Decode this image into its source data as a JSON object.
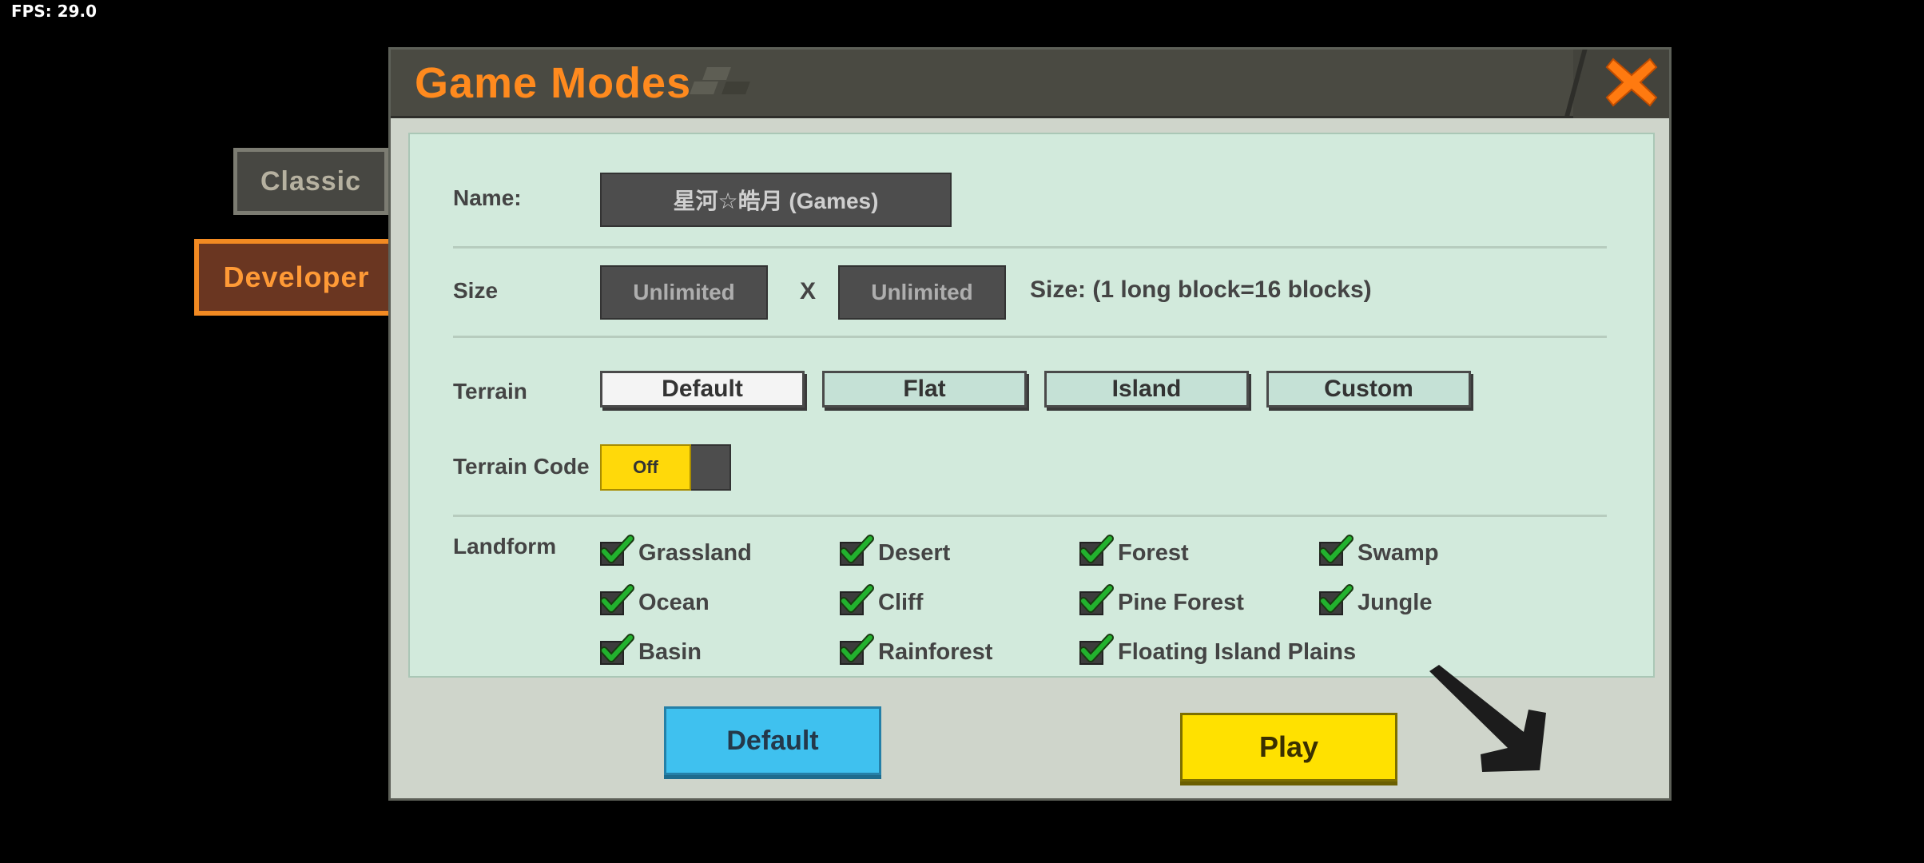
{
  "fps": "FPS: 29.0",
  "tabs": {
    "classic": "Classic",
    "developer": "Developer"
  },
  "dialog": {
    "title": "Game Modes",
    "name_label": "Name:",
    "name_value": "星河☆皓月 (Games)",
    "size_label": "Size",
    "size_width": "Unlimited",
    "size_x": "X",
    "size_height": "Unlimited",
    "size_note": "Size: (1 long block=16 blocks)",
    "terrain_label": "Terrain",
    "terrain_options": [
      "Default",
      "Flat",
      "Island",
      "Custom"
    ],
    "terrain_selected": "Default",
    "terrain_code_label": "Terrain Code",
    "terrain_code_toggle": "Off",
    "landform_label": "Landform",
    "landforms": [
      "Grassland",
      "Desert",
      "Forest",
      "Swamp",
      "Ocean",
      "Cliff",
      "Pine Forest",
      "Jungle",
      "Basin",
      "Rainforest",
      "Floating Island Plains"
    ],
    "default_button": "Default",
    "play_button": "Play"
  },
  "colors": {
    "accent_orange": "#ff8a1e",
    "play_yellow": "#ffe100",
    "default_blue": "#3fc1ef",
    "content_green": "#d2eadc"
  }
}
